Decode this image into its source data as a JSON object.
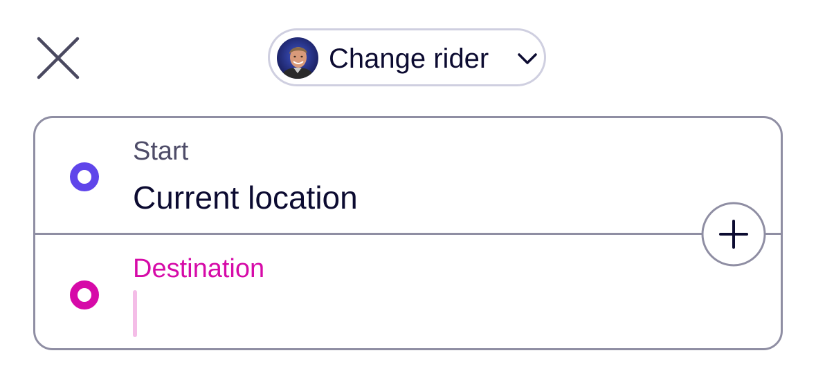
{
  "header": {
    "close_icon": "close-icon",
    "rider_button": {
      "label": "Change rider",
      "avatar": "rider-avatar-photo",
      "chevron_icon": "chevron-down-icon"
    }
  },
  "route": {
    "start": {
      "label": "Start",
      "value": "Current location",
      "dot_color": "#5f45ea"
    },
    "destination": {
      "label": "Destination",
      "value": "",
      "dot_color": "#d60aa8"
    },
    "add_stop_icon": "plus-icon"
  },
  "colors": {
    "text_primary": "#0c0b31",
    "label_secondary": "#4e4c68",
    "destination_accent": "#d60aa8",
    "start_accent": "#5f45ea",
    "border": "#8f8ea3"
  }
}
